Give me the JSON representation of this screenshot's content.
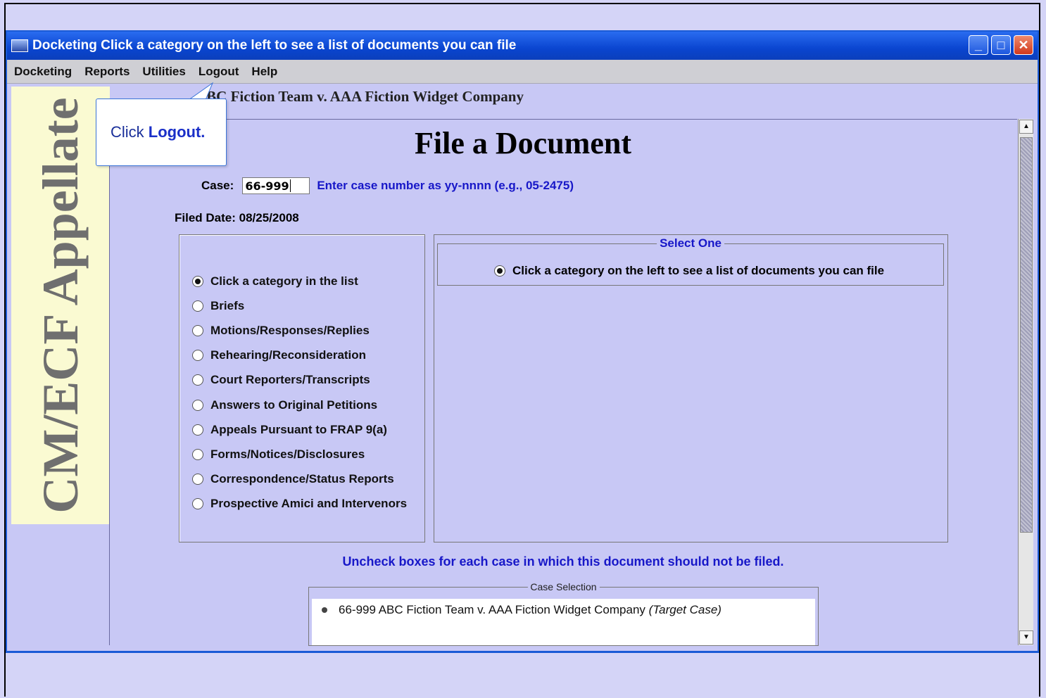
{
  "window": {
    "title": "Docketing Click a category on the left to see a list of documents you can file",
    "controls": {
      "minimize": "minimize-icon",
      "maximize": "maximize-icon",
      "close": "close-icon"
    }
  },
  "menu": [
    "Docketing",
    "Reports",
    "Utilities",
    "Logout",
    "Help"
  ],
  "sidebar_brand": "CM/ECF Appellate",
  "case_caption": "Case 66-999 ABC Fiction Team v. AAA Fiction Widget Company",
  "case_caption_visible": "BC Fiction Team v. AAA Fiction Widget Company",
  "callout": {
    "prefix": "Click ",
    "action": "Logout."
  },
  "page_title": "File a Document",
  "case_field": {
    "label": "Case:",
    "value": "66-999",
    "hint": "Enter case number as yy-nnnn (e.g., 05-2475)"
  },
  "filed_date": {
    "label": "Filed Date:",
    "value": "08/25/2008"
  },
  "categories": [
    {
      "label": "Click a category in the list",
      "selected": true
    },
    {
      "label": "Briefs",
      "selected": false
    },
    {
      "label": "Motions/Responses/Replies",
      "selected": false
    },
    {
      "label": "Rehearing/Reconsideration",
      "selected": false
    },
    {
      "label": "Court Reporters/Transcripts",
      "selected": false
    },
    {
      "label": "Answers to Original Petitions",
      "selected": false
    },
    {
      "label": "Appeals Pursuant to FRAP 9(a)",
      "selected": false
    },
    {
      "label": "Forms/Notices/Disclosures",
      "selected": false
    },
    {
      "label": "Correspondence/Status Reports",
      "selected": false
    },
    {
      "label": "Prospective Amici and Intervenors",
      "selected": false
    }
  ],
  "select_one": {
    "legend": "Select One",
    "option": "Click a category on the left to see a list of documents you can file"
  },
  "uncheck_note": "Uncheck boxes for each case in which this document should not be filed.",
  "case_selection": {
    "legend": "Case Selection",
    "entry": "66-999 ABC Fiction Team v. AAA Fiction Widget Company",
    "entry_tag": "(Target Case)"
  },
  "colors": {
    "background": "#c8c8f5",
    "titlebar": "#0a45d0",
    "link_blue": "#1717c8",
    "sidebar": "#fafad2"
  }
}
